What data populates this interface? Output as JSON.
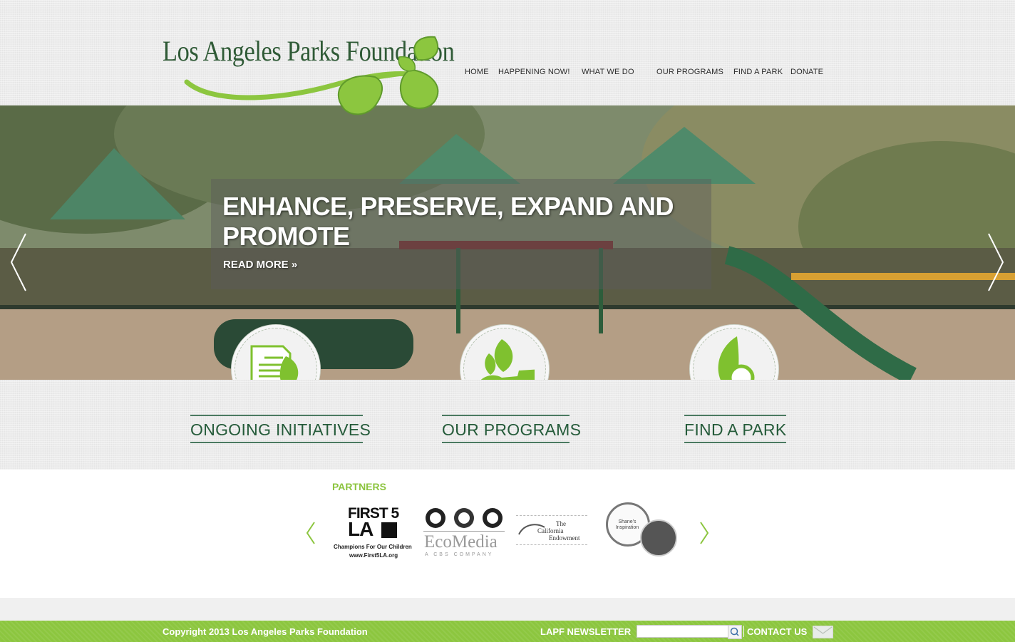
{
  "brand": {
    "name": "Los Angeles Parks Foundation",
    "accent": "#8cc63f",
    "dark_green": "#255b3a"
  },
  "nav": [
    {
      "label": "HOME"
    },
    {
      "label": "HAPPENING NOW!"
    },
    {
      "label": "WHAT WE DO"
    },
    {
      "label": "OUR PROGRAMS"
    },
    {
      "label": "FIND A PARK"
    },
    {
      "label": "DONATE"
    }
  ],
  "hero": {
    "title": "ENHANCE, PRESERVE, EXPAND AND PROMOTE",
    "read_more": "READ MORE »",
    "prev_icon": "chevron-left-icon",
    "next_icon": "chevron-right-icon"
  },
  "features": [
    {
      "label": "ONGOING INITIATIVES",
      "icon": "document-leaf-icon"
    },
    {
      "label": "OUR PROGRAMS",
      "icon": "hand-leaf-icon"
    },
    {
      "label": "FIND A PARK",
      "icon": "leaf-magnifier-icon"
    }
  ],
  "partners": {
    "title": "PARTNERS",
    "logos": [
      {
        "name": "first5la",
        "line1": "FIRST 5",
        "line2": "LA",
        "tagline": "Champions For Our Children",
        "url": "www.First5LA.org"
      },
      {
        "name": "ecomedia",
        "text": "EcoMedia",
        "tagline": "A CBS COMPANY"
      },
      {
        "name": "california-endowment",
        "text1": "The",
        "text2": "California",
        "text3": "Endowment"
      },
      {
        "name": "shanes-inspiration",
        "text": "Shane's Inspiration"
      }
    ]
  },
  "footer": {
    "copyright": "Copyright 2013 Los Angeles Parks Foundation",
    "newsletter_label": "LAPF NEWSLETTER",
    "newsletter_placeholder": "",
    "contact": "CONTACT US"
  }
}
